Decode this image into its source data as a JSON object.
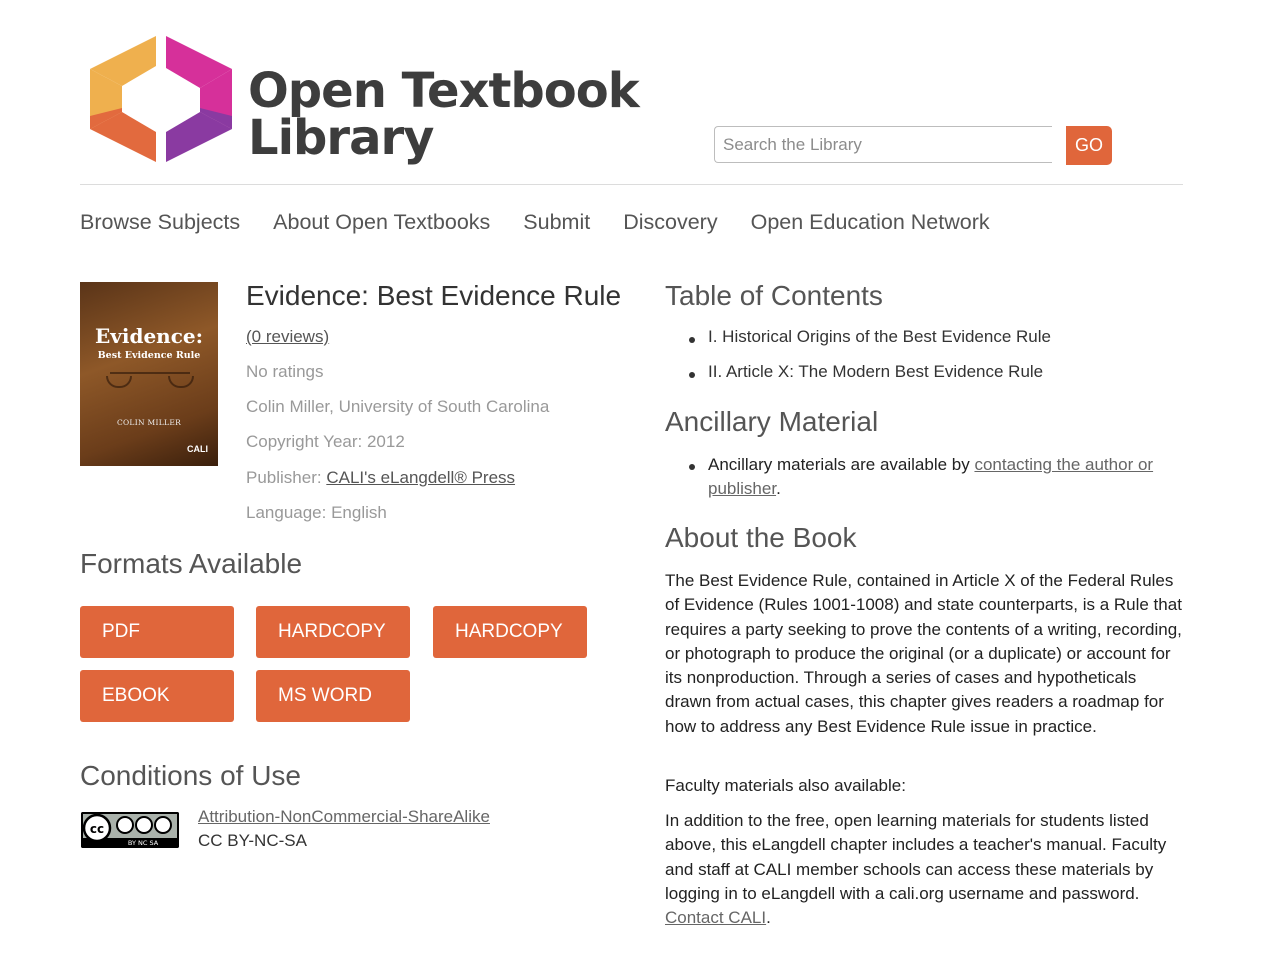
{
  "header": {
    "logo_line1": "Open Textbook",
    "logo_line2": "Library",
    "search_placeholder": "Search the Library",
    "search_button": "GO"
  },
  "nav": [
    "Browse Subjects",
    "About Open Textbooks",
    "Submit",
    "Discovery",
    "Open Education Network"
  ],
  "book": {
    "cover_title": "Evidence:",
    "cover_subtitle": "Best Evidence Rule",
    "cover_author": "COLIN MILLER",
    "cover_publisher": "CALI",
    "title": "Evidence: Best Evidence Rule",
    "reviews": "(0 reviews)",
    "ratings": "No ratings",
    "author": "Colin Miller, University of South Carolina",
    "copyright": "Copyright Year: 2012",
    "publisher_label": "Publisher: ",
    "publisher": "CALI's eLangdell® Press",
    "language": "Language: English"
  },
  "formats": {
    "heading": "Formats Available",
    "buttons": [
      "PDF",
      "HARDCOPY",
      "HARDCOPY",
      "EBOOK",
      "MS WORD"
    ]
  },
  "conditions": {
    "heading": "Conditions of Use",
    "license_name": "Attribution-NonCommercial-ShareAlike",
    "license_code": "CC BY-NC-SA",
    "badge_text": "BY  NC  SA"
  },
  "toc": {
    "heading": "Table of Contents",
    "items": [
      "I. Historical Origins of the Best Evidence Rule",
      "II. Article X: The Modern Best Evidence Rule"
    ]
  },
  "ancillary": {
    "heading": "Ancillary Material",
    "text": "Ancillary materials are available by ",
    "link": "contacting the author or publisher",
    "end": "."
  },
  "about": {
    "heading": "About the Book",
    "description": "The Best Evidence Rule, contained in Article X of the Federal Rules of Evidence (Rules 1001-1008) and state counterparts, is a Rule that requires a party seeking to prove the contents of a writing, recording, or photograph to produce the original (or a duplicate) or account for its nonproduction. Through a series of cases and hypotheticals drawn from actual cases, this chapter gives readers a roadmap for how to address any Best Evidence Rule issue in practice.",
    "faculty_heading": "Faculty materials also available:",
    "faculty_text": "In addition to the free, open learning materials for students listed above, this eLangdell chapter includes a teacher's manual. Faculty and staff at CALI member schools can access these materials by logging in to eLangdell with a cali.org username and password. ",
    "contact_link": "Contact CALI",
    "contact_end": "."
  }
}
